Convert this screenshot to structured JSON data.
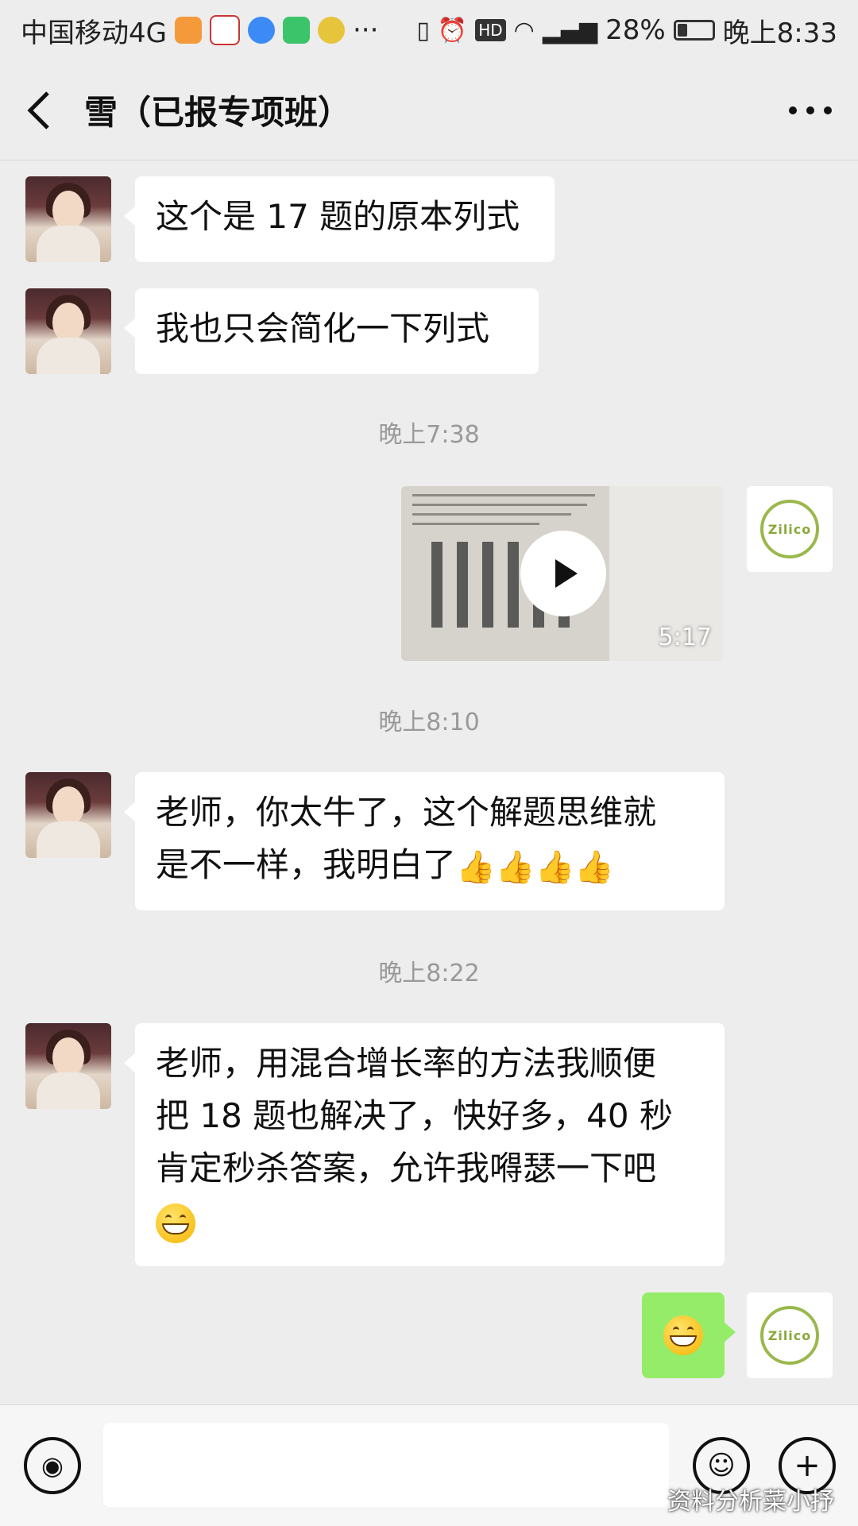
{
  "status_bar": {
    "carrier": "中国移动4G",
    "icons": [
      "video-app-icon",
      "study-app-icon",
      "browser-app-icon",
      "player-app-icon",
      "photo-app-icon",
      "more-dots"
    ],
    "dots": "···",
    "hd": "HD",
    "battery_text": "28%",
    "battery_level": 0.28,
    "time": "晚上8:33"
  },
  "header": {
    "title": "雪（已报专项班）"
  },
  "messages": [
    {
      "side": "left",
      "text": "这个是 17 题的原本列式"
    },
    {
      "side": "left",
      "text": "我也只会简化一下列式"
    },
    {
      "side": "right",
      "type": "video",
      "duration": "5:17"
    },
    {
      "side": "left",
      "text_line1": "老师，你太牛了，这个解题思维就",
      "text_line2": "是不一样，我明白了",
      "emoji": "👍👍👍👍"
    },
    {
      "side": "left",
      "text_line1": "老师，用混合增长率的方法我顺便",
      "text_line2": "把 18 题也解决了，快好多，40 秒",
      "text_line3": "肯定秒杀答案，允许我嘚瑟一下吧"
    },
    {
      "side": "right",
      "type": "emoji-grin"
    }
  ],
  "timestamps": [
    "晚上7:38",
    "晚上8:10",
    "晚上8:22"
  ],
  "avatar_right_text": "Zilico",
  "watermark": "资料分析菜小抒",
  "colors": {
    "background": "#ededed",
    "bubble_right": "#95ec69",
    "bubble_left": "#ffffff"
  }
}
